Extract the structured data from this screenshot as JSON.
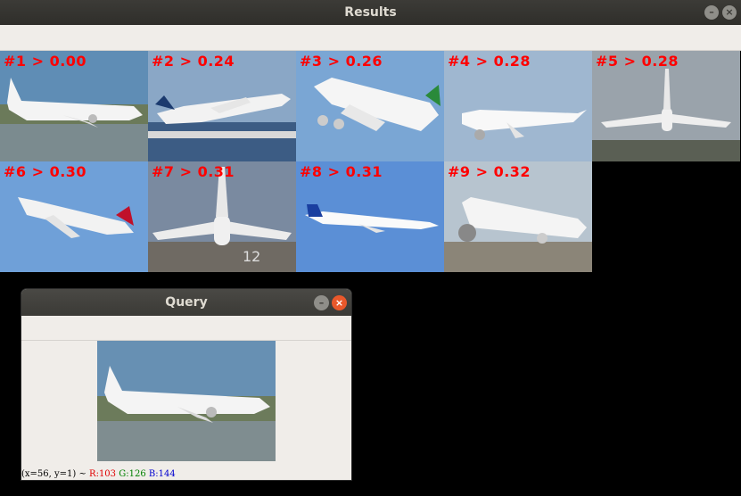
{
  "results_window": {
    "title": "Results",
    "results": [
      {
        "label": "#1 > 0.00",
        "selected": true
      },
      {
        "label": "#2 > 0.24",
        "selected": false
      },
      {
        "label": "#3 > 0.26",
        "selected": false
      },
      {
        "label": "#4 > 0.28",
        "selected": false
      },
      {
        "label": "#5 > 0.28",
        "selected": false
      },
      {
        "label": "#6 > 0.30",
        "selected": false
      },
      {
        "label": "#7 > 0.31",
        "selected": false
      },
      {
        "label": "#8 > 0.31",
        "selected": false
      },
      {
        "label": "#9 > 0.32",
        "selected": false
      }
    ],
    "label_color": "#ff0000",
    "selection_color": "#00e000"
  },
  "query_window": {
    "title": "Query",
    "status": {
      "coords": "(x=56, y=1) ~",
      "r": "R:103",
      "g": "G:126",
      "b": "B:144"
    }
  },
  "icons": {
    "minimize": "minimize-icon",
    "close": "close-icon"
  }
}
